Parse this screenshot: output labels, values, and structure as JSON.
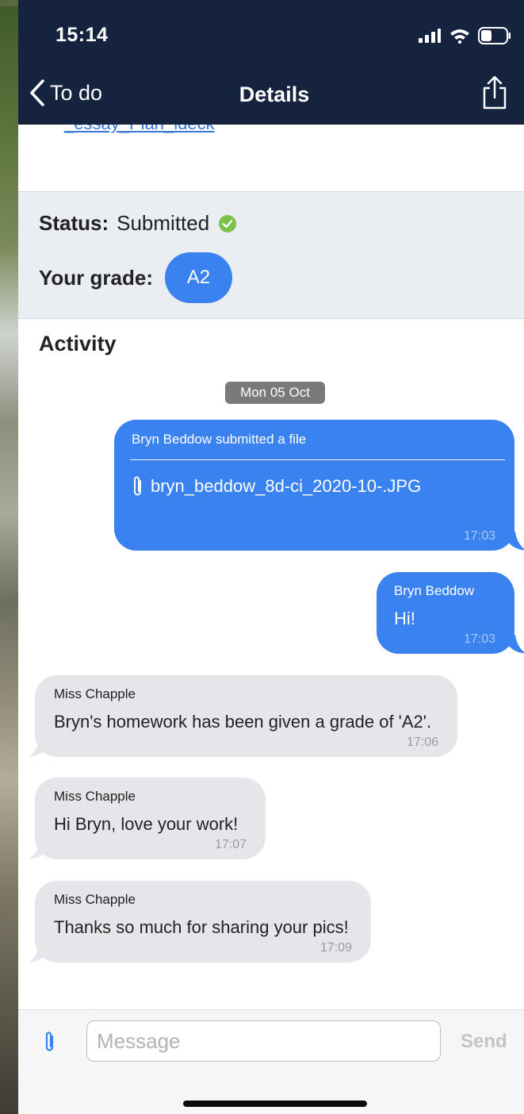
{
  "status_bar": {
    "time": "15:14"
  },
  "nav": {
    "back_label": "To do",
    "title": "Details"
  },
  "top": {
    "cut_link_text": "_essay_Plan_ideck"
  },
  "status_panel": {
    "status_label": "Status:",
    "status_value": "Submitted",
    "grade_label": "Your grade:",
    "grade_value": "A2"
  },
  "activity": {
    "title": "Activity",
    "date_chip": "Mon 05 Oct",
    "messages": [
      {
        "direction": "out",
        "header": "Bryn Beddow submitted a file",
        "file_name": "bryn_beddow_8d-ci_2020-10-.JPG",
        "time": "17:03"
      },
      {
        "direction": "out",
        "sender": "Bryn Beddow",
        "text": "Hi!",
        "time": "17:03"
      },
      {
        "direction": "in",
        "sender": "Miss Chapple",
        "text": "Bryn's homework has been given a grade of 'A2'.",
        "time": "17:06"
      },
      {
        "direction": "in",
        "sender": "Miss Chapple",
        "text": "Hi Bryn, love your work!",
        "time": "17:07"
      },
      {
        "direction": "in",
        "sender": "Miss Chapple",
        "text": "Thanks so much for sharing your pics!",
        "time": "17:09"
      }
    ]
  },
  "composer": {
    "placeholder": "Message",
    "send_label": "Send"
  },
  "colors": {
    "header_bg": "#15233f",
    "accent": "#3a82f0",
    "incoming_bubble": "#e6e6ea",
    "status_ok": "#7bc24b"
  },
  "icons": [
    "signal-icon",
    "wifi-icon",
    "battery-icon",
    "chevron-left-icon",
    "share-icon",
    "check-circle-icon",
    "paperclip-icon"
  ]
}
